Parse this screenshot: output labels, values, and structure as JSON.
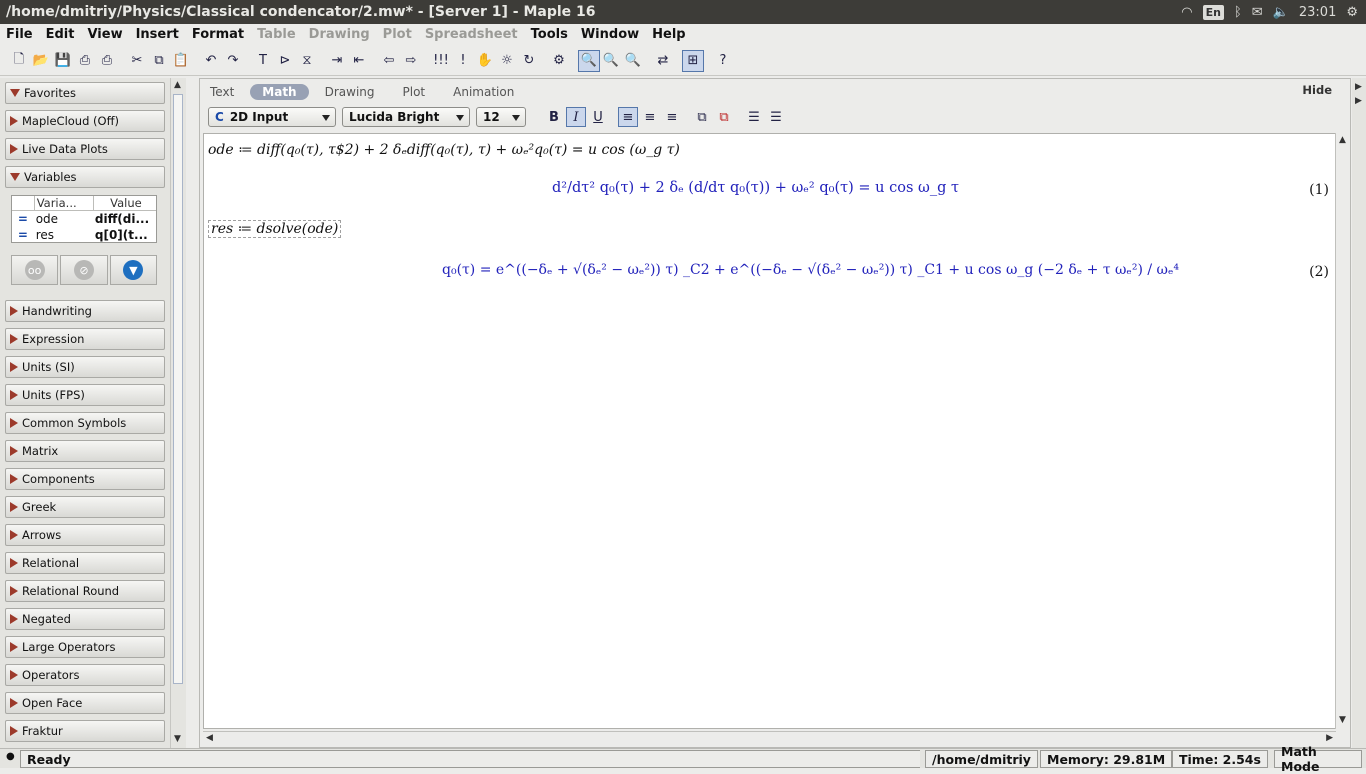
{
  "window": {
    "title": "/home/dmitriy/Physics/Classical condencator/2.mw* - [Server 1] - Maple 16",
    "keyboard_layout": "En",
    "clock": "23:01"
  },
  "menu": [
    "File",
    "Edit",
    "View",
    "Insert",
    "Format",
    "Table",
    "Drawing",
    "Plot",
    "Spreadsheet",
    "Tools",
    "Window",
    "Help"
  ],
  "menu_disabled": [
    "Table",
    "Drawing",
    "Plot",
    "Spreadsheet"
  ],
  "sidebar": {
    "favorites": "Favorites",
    "maplecloud": "MapleCloud (Off)",
    "live_data_plots": "Live Data Plots",
    "variables": "Variables",
    "var_headers": {
      "name": "Varia...",
      "value": "Value"
    },
    "var_rows": [
      {
        "name": "ode",
        "value": "diff(di..."
      },
      {
        "name": "res",
        "value": "q[0](t..."
      }
    ],
    "palettes": [
      "Handwriting",
      "Expression",
      "Units (SI)",
      "Units (FPS)",
      "Common Symbols",
      "Matrix",
      "Components",
      "Greek",
      "Arrows",
      "Relational",
      "Relational Round",
      "Negated",
      "Large Operators",
      "Operators",
      "Open Face",
      "Fraktur"
    ]
  },
  "context_tabs": [
    "Text",
    "Math",
    "Drawing",
    "Plot",
    "Animation"
  ],
  "active_tab": "Math",
  "hide_label": "Hide",
  "format": {
    "input_mode": "2D Input",
    "font": "Lucida Bright",
    "size": "12"
  },
  "document": {
    "ode_input": "ode ≔ diff(q₀(τ), τ$2) + 2 δₑdiff(q₀(τ), τ) + ωₑ²q₀(τ) = u cos (ω_g τ)",
    "ode_output": "d²/dτ² q₀(τ) + 2 δₑ (d/dτ q₀(τ)) + ωₑ² q₀(τ) = u cos ω_g τ",
    "eq1": "(1)",
    "res_input": "res ≔ dsolve(ode)",
    "res_output": "q₀(τ) = e^((−δₑ + √(δₑ² − ωₑ²)) τ) _C2 + e^((−δₑ − √(δₑ² − ωₑ²)) τ) _C1 + u cos ω_g (−2 δₑ + τ ωₑ²) / ωₑ⁴",
    "eq2": "(2)"
  },
  "status": {
    "ready": "Ready",
    "dir": "/home/dmitriy",
    "memory": "Memory: 29.81M",
    "time": "Time: 2.54s",
    "mode": "Math Mode"
  }
}
